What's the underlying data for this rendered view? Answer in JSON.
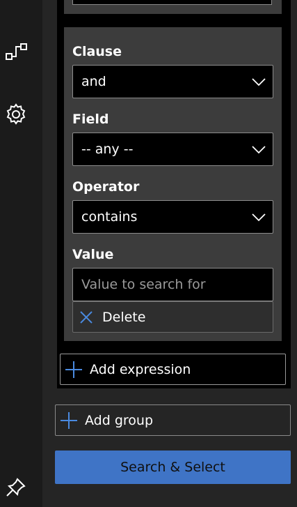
{
  "rail": {
    "icons": [
      "flow-connector-icon",
      "settings-gear-icon",
      "pin-icon"
    ]
  },
  "expression": {
    "clause_label": "Clause",
    "clause_value": "and",
    "field_label": "Field",
    "field_value": "-- any --",
    "operator_label": "Operator",
    "operator_value": "contains",
    "value_label": "Value",
    "value_placeholder": "Value to search for",
    "value_text": "",
    "delete_label": "Delete"
  },
  "actions": {
    "add_expression_label": "Add expression",
    "add_group_label": "Add group",
    "search_select_label": "Search & Select"
  },
  "colors": {
    "accent": "#3f74c6",
    "icon_accent": "#4a8ae0",
    "background": "#1b1b1b",
    "panel": "#252525",
    "expression_card": "#3c3c3c"
  }
}
